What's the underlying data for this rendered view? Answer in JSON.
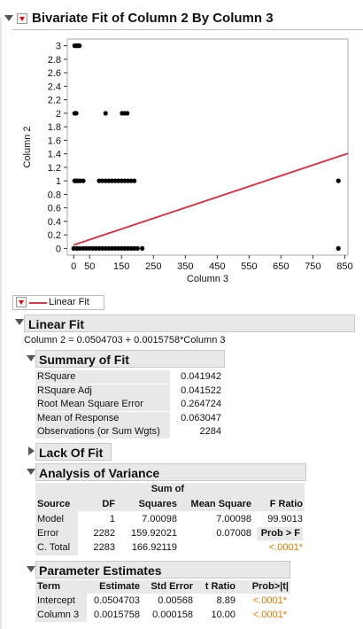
{
  "report": {
    "title": "Bivariate Fit of Column 2 By Column 3"
  },
  "chart_data": {
    "type": "scatter",
    "xlabel": "Column 3",
    "ylabel": "Column 2",
    "xlim": [
      -20,
      860
    ],
    "ylim": [
      -0.1,
      3.1
    ],
    "x_ticks": [
      0,
      50,
      150,
      250,
      350,
      450,
      550,
      650,
      750,
      850
    ],
    "y_ticks": [
      "0",
      "0.2",
      "0.4",
      "0.6",
      "0.8",
      "1",
      "1.2",
      "1.4",
      "1.6",
      "1.8",
      "2",
      "2.2",
      "2.4",
      "2.6",
      "2.8",
      "3"
    ],
    "points": [
      {
        "x": 3,
        "y": 3
      },
      {
        "x": 8,
        "y": 3
      },
      {
        "x": 13,
        "y": 3
      },
      {
        "x": 18,
        "y": 3
      },
      {
        "x": 3,
        "y": 2
      },
      {
        "x": 8,
        "y": 2
      },
      {
        "x": 100,
        "y": 2
      },
      {
        "x": 152,
        "y": 2
      },
      {
        "x": 160,
        "y": 2
      },
      {
        "x": 168,
        "y": 2
      },
      {
        "x": 3,
        "y": 1
      },
      {
        "x": 8,
        "y": 1
      },
      {
        "x": 13,
        "y": 1
      },
      {
        "x": 20,
        "y": 1
      },
      {
        "x": 30,
        "y": 1
      },
      {
        "x": 80,
        "y": 1
      },
      {
        "x": 90,
        "y": 1
      },
      {
        "x": 100,
        "y": 1
      },
      {
        "x": 110,
        "y": 1
      },
      {
        "x": 120,
        "y": 1
      },
      {
        "x": 130,
        "y": 1
      },
      {
        "x": 140,
        "y": 1
      },
      {
        "x": 150,
        "y": 1
      },
      {
        "x": 160,
        "y": 1
      },
      {
        "x": 170,
        "y": 1
      },
      {
        "x": 180,
        "y": 1
      },
      {
        "x": 190,
        "y": 1
      },
      {
        "x": 830,
        "y": 1
      },
      {
        "x": 0,
        "y": 0
      },
      {
        "x": 10,
        "y": 0
      },
      {
        "x": 20,
        "y": 0
      },
      {
        "x": 30,
        "y": 0
      },
      {
        "x": 40,
        "y": 0
      },
      {
        "x": 50,
        "y": 0
      },
      {
        "x": 60,
        "y": 0
      },
      {
        "x": 70,
        "y": 0
      },
      {
        "x": 80,
        "y": 0
      },
      {
        "x": 90,
        "y": 0
      },
      {
        "x": 100,
        "y": 0
      },
      {
        "x": 110,
        "y": 0
      },
      {
        "x": 120,
        "y": 0
      },
      {
        "x": 130,
        "y": 0
      },
      {
        "x": 140,
        "y": 0
      },
      {
        "x": 150,
        "y": 0
      },
      {
        "x": 160,
        "y": 0
      },
      {
        "x": 170,
        "y": 0
      },
      {
        "x": 180,
        "y": 0
      },
      {
        "x": 190,
        "y": 0
      },
      {
        "x": 200,
        "y": 0
      },
      {
        "x": 215,
        "y": 0
      },
      {
        "x": 830,
        "y": 0
      }
    ],
    "fit_line": {
      "intercept": 0.0504703,
      "slope": 0.0015758,
      "color": "#c8404a"
    },
    "point_color": "#000000"
  },
  "legend": {
    "label": "Linear Fit",
    "color": "#c8404a"
  },
  "linear_fit": {
    "title": "Linear Fit",
    "equation": "Column 2 = 0.0504703 + 0.0015758*Column 3"
  },
  "summary_of_fit": {
    "title": "Summary of Fit",
    "rows": [
      {
        "label": "RSquare",
        "value": "0.041942"
      },
      {
        "label": "RSquare Adj",
        "value": "0.041522"
      },
      {
        "label": "Root Mean Square Error",
        "value": "0.264724"
      },
      {
        "label": "Mean of Response",
        "value": "0.063047"
      },
      {
        "label": "Observations (or Sum Wgts)",
        "value": "2284"
      }
    ]
  },
  "lack_of_fit": {
    "title": "Lack Of Fit"
  },
  "anova": {
    "title": "Analysis of Variance",
    "headers": {
      "source": "Source",
      "df": "DF",
      "ss_top": "Sum of",
      "ss": "Squares",
      "ms": "Mean Square",
      "f": "F Ratio"
    },
    "rows": [
      {
        "source": "Model",
        "df": "1",
        "ss": "7.00098",
        "ms": "7.00098",
        "f": "99.9013"
      },
      {
        "source": "Error",
        "df": "2282",
        "ss": "159.92021",
        "ms": "0.07008",
        "f": "Prob > F"
      },
      {
        "source": "C. Total",
        "df": "2283",
        "ss": "166.92119",
        "ms": "",
        "f": "<.0001*"
      }
    ]
  },
  "param_estimates": {
    "title": "Parameter Estimates",
    "headers": {
      "term": "Term",
      "est": "Estimate",
      "se": "Std Error",
      "t": "t Ratio",
      "p": "Prob>|t|"
    },
    "rows": [
      {
        "term": "Intercept",
        "est": "0.0504703",
        "se": "0.00568",
        "t": "8.89",
        "p": "<.0001*"
      },
      {
        "term": "Column 3",
        "est": "0.0015758",
        "se": "0.000158",
        "t": "10.00",
        "p": "<.0001*"
      }
    ]
  }
}
